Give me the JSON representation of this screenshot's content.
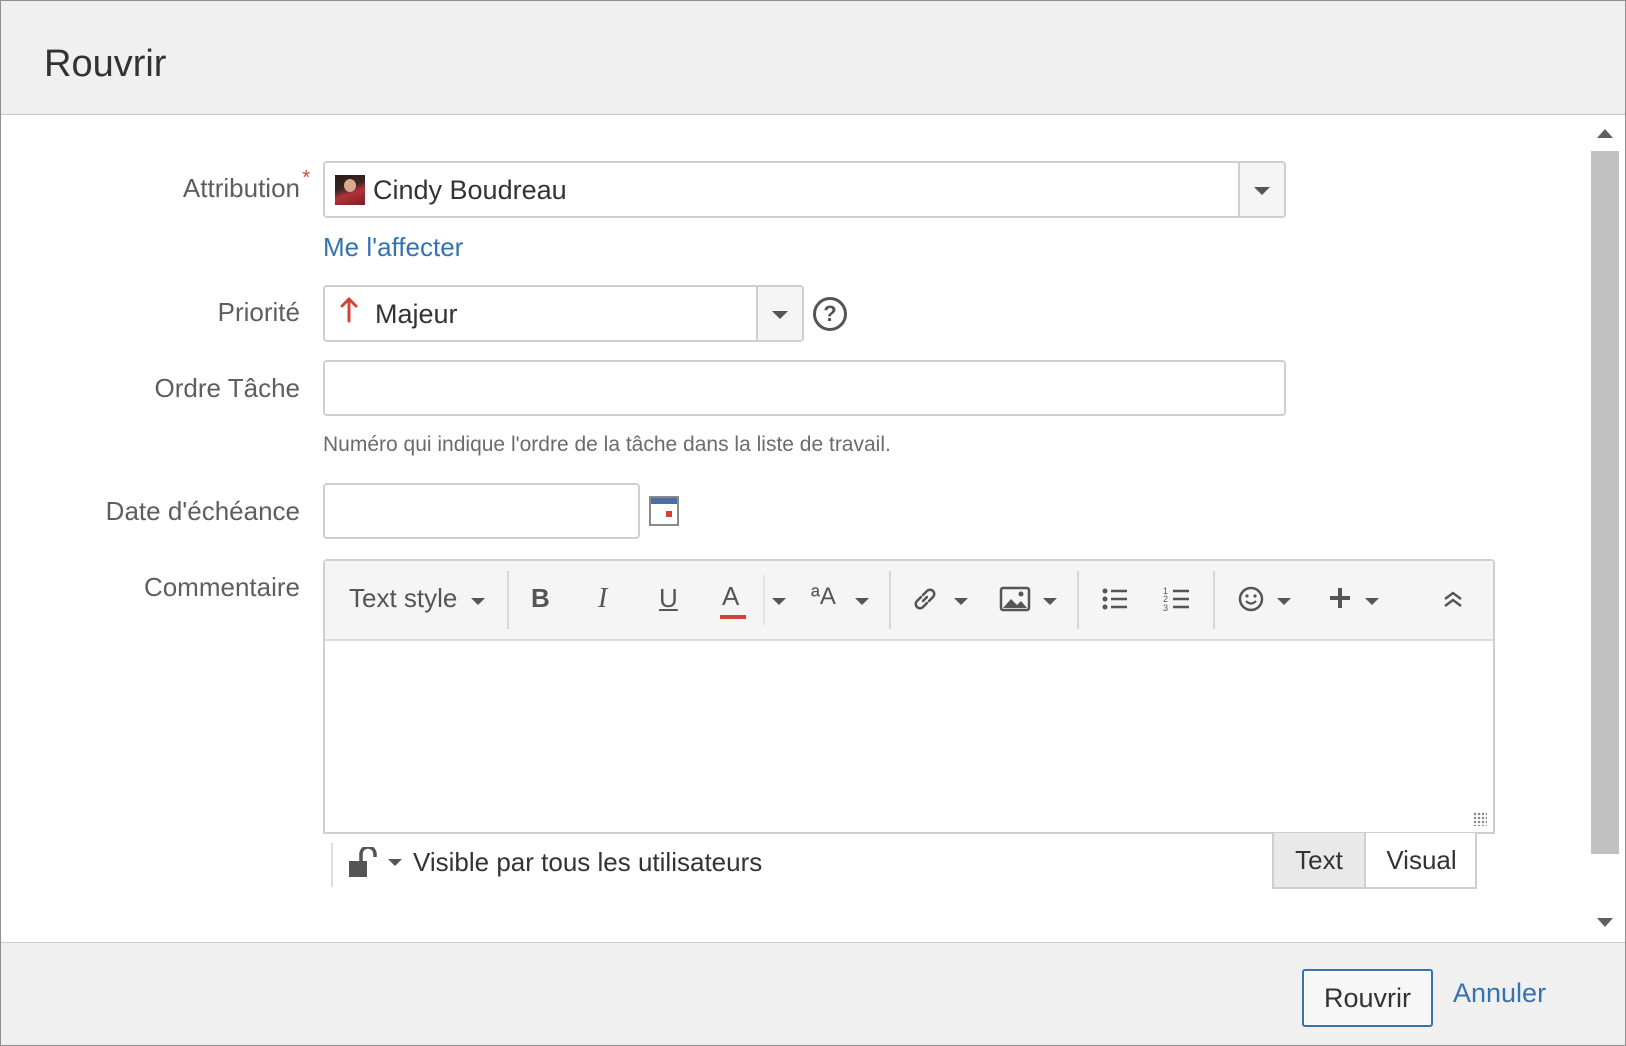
{
  "dialog": {
    "title": "Rouvrir"
  },
  "fields": {
    "assignee": {
      "label": "Attribution",
      "required_mark": "*",
      "value": "Cindy Boudreau",
      "assign_to_me": "Me l'affecter"
    },
    "priority": {
      "label": "Priorité",
      "value": "Majeur",
      "help": "?"
    },
    "task_order": {
      "label": "Ordre Tâche",
      "value": "",
      "description": "Numéro qui indique l'ordre de la tâche dans la liste de travail."
    },
    "due_date": {
      "label": "Date d'échéance",
      "value": ""
    },
    "comment": {
      "label": "Commentaire",
      "value": ""
    }
  },
  "editor": {
    "text_style": "Text style",
    "bold": "B",
    "italic": "I",
    "underline": "U",
    "text_color": "A",
    "format_more": "ªA",
    "toolbar_icons": [
      "link-icon",
      "image-icon",
      "bullet-list-icon",
      "numbered-list-icon",
      "emoticon-icon",
      "plus-icon",
      "collapse-icon"
    ],
    "text_color_accent": "#d04437",
    "visibility": "Visible par tous les utilisateurs",
    "mode_text": "Text",
    "mode_visual": "Visual"
  },
  "footer": {
    "submit": "Rouvrir",
    "cancel": "Annuler"
  },
  "colors": {
    "link": "#3572b0",
    "required": "#d04437",
    "priority_arrow": "#d04437"
  }
}
